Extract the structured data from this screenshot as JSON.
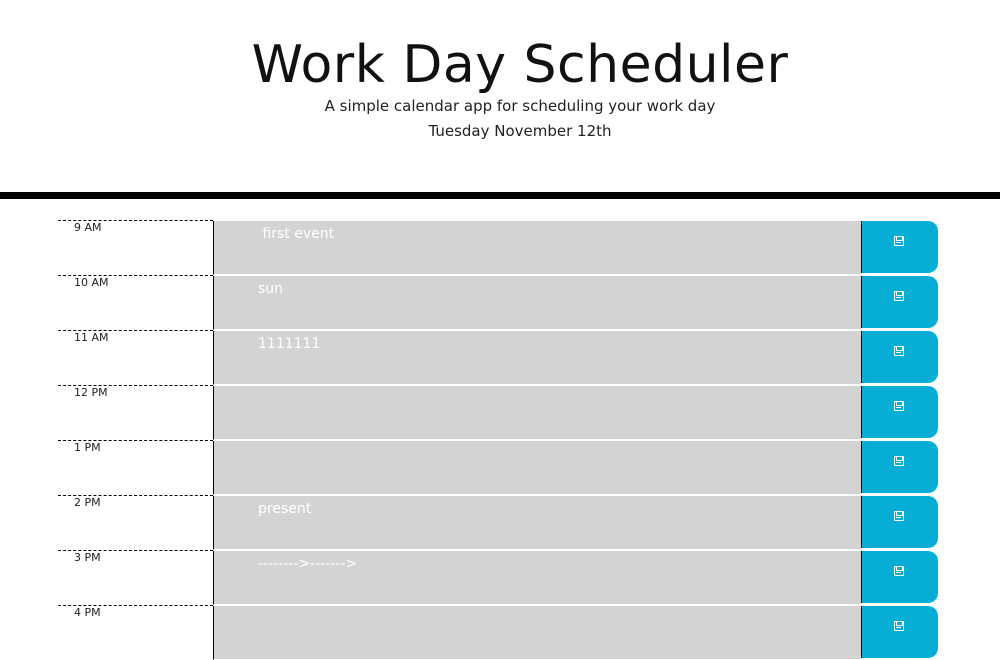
{
  "header": {
    "title": "Work Day Scheduler",
    "lead": "A simple calendar app for scheduling your work day",
    "current_day": "Tuesday November 12th"
  },
  "schedule": {
    "blocks": [
      {
        "hour": "9 AM",
        "description": " first event"
      },
      {
        "hour": "10 AM",
        "description": "sun"
      },
      {
        "hour": "11 AM",
        "description": "1111111"
      },
      {
        "hour": "12 PM",
        "description": ""
      },
      {
        "hour": "1 PM",
        "description": ""
      },
      {
        "hour": "2 PM",
        "description": "present"
      },
      {
        "hour": "3 PM",
        "description": "-------->------->"
      },
      {
        "hour": "4 PM",
        "description": ""
      }
    ],
    "save_icon": "save-icon"
  },
  "colors": {
    "description_bg": "#d3d3d3",
    "save_button_bg": "#06aed5",
    "divider": "#000000"
  }
}
